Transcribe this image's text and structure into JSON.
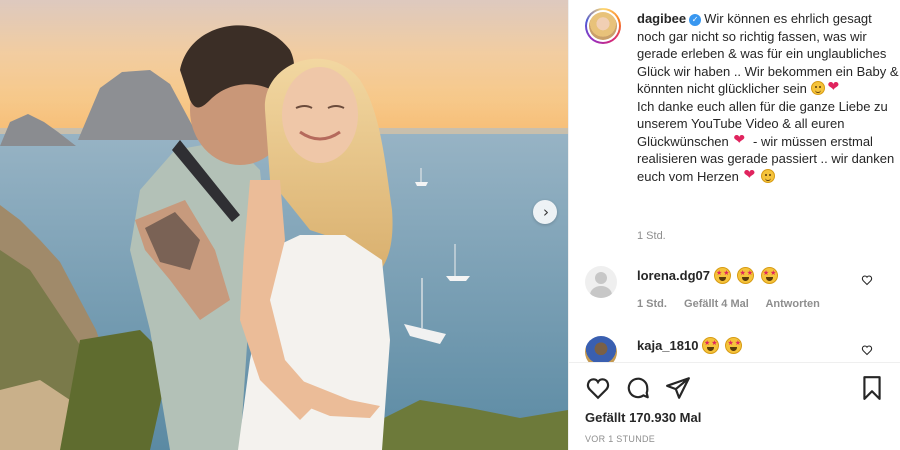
{
  "post": {
    "username": "dagibee",
    "verified": true,
    "caption_part1": "Wir können es ehrlich gesagt noch gar nicht so richtig fassen, was wir gerade erleben & was für ein unglaubliches Glück wir haben .. Wir bekommen ein Baby & könnten nicht glücklicher sein",
    "caption_part2": "Ich danke euch allen für die ganze Liebe zu unserem YouTube Video & all euren Glückwünschen",
    "caption_part3": "- wir müssen erstmal realisieren was gerade passiert .. wir danken euch vom Herzen",
    "time": "1 Std."
  },
  "comments": [
    {
      "username": "lorena.dg07",
      "emojis": [
        "heart-eyes",
        "heart-eyes",
        "heart-eyes"
      ],
      "time": "1 Std.",
      "likes": "Gefällt 4 Mal",
      "reply": "Antworten"
    },
    {
      "username": "kaja_1810",
      "emojis": [
        "heart-eyes",
        "heart-eyes"
      ]
    }
  ],
  "actions": {
    "icons": [
      "heart-icon",
      "comment-icon",
      "share-icon",
      "bookmark-icon"
    ],
    "likes_text": "Gefällt 170.930 Mal",
    "ago_text": "VOR 1 STUNDE"
  },
  "colors": {
    "verified": "#3897f0",
    "muted_text": "#8e8e8e",
    "heart": "#e0245e"
  }
}
